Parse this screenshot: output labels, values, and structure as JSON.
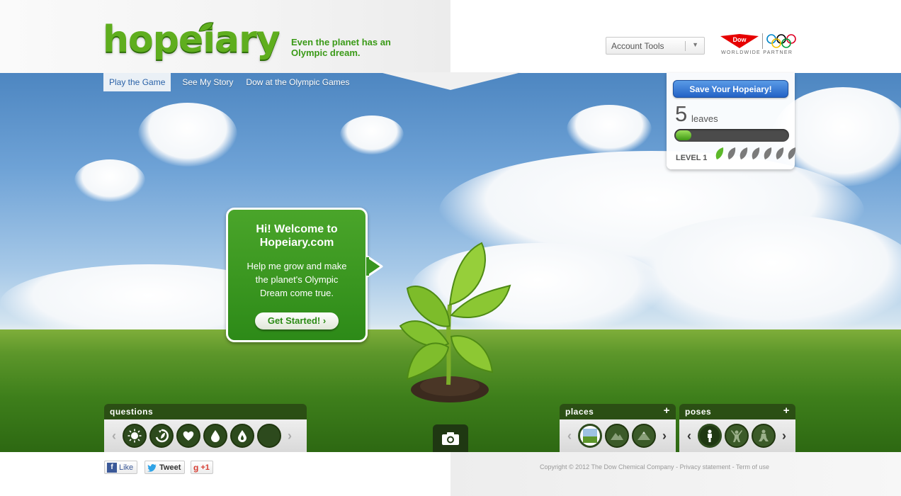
{
  "brand": {
    "logo_text": "hopeiary",
    "tagline": "Even the planet has an Olympic dream.",
    "partner_logo_text": "Dow",
    "partner_text": "WORLDWIDE PARTNER",
    "colors": {
      "green": "#5fae1e",
      "blue_button": "#2463c6",
      "widget_header": "#2d4a1d"
    }
  },
  "header": {
    "account_tools": "Account Tools"
  },
  "nav": {
    "items": [
      {
        "label": "Play the Game",
        "active": true
      },
      {
        "label": "See My Story",
        "active": false
      },
      {
        "label": "Dow at the Olympic Games",
        "active": false
      }
    ]
  },
  "save_panel": {
    "button": "Save Your Hopeiary!",
    "leaf_count": "5",
    "leaf_word": "leaves",
    "progress_fraction": 0.14,
    "level_label": "LEVEL 1",
    "level_leaves_total": 7,
    "level_leaves_filled": 1
  },
  "welcome": {
    "title_line1": "Hi! Welcome to",
    "title_line2": "Hopeiary.com",
    "text_line1": "Help me grow and make",
    "text_line2": "the planet's Olympic",
    "text_line3": "Dream come true.",
    "button": "Get Started!  ›"
  },
  "widgets": {
    "questions": {
      "title": "questions",
      "icons": [
        "sun-icon",
        "recycle-icon",
        "heart-icon",
        "water-drop-icon",
        "fire-drop-icon",
        "blank-icon"
      ]
    },
    "places": {
      "title": "places",
      "plus": "+",
      "icons": [
        "field-place-icon",
        "mountain-place-icon",
        "peak-place-icon"
      ]
    },
    "poses": {
      "title": "poses",
      "plus": "+",
      "icons": [
        "standing-pose-icon",
        "arms-up-pose-icon",
        "sitting-pose-icon"
      ]
    }
  },
  "footer": {
    "like": "Like",
    "tweet": "Tweet",
    "plus_one": "+1",
    "copyright": "Copyright © 2012 The Dow Chemical Company",
    "separator": " - ",
    "privacy": "Privacy statement",
    "terms": "Term of use"
  }
}
